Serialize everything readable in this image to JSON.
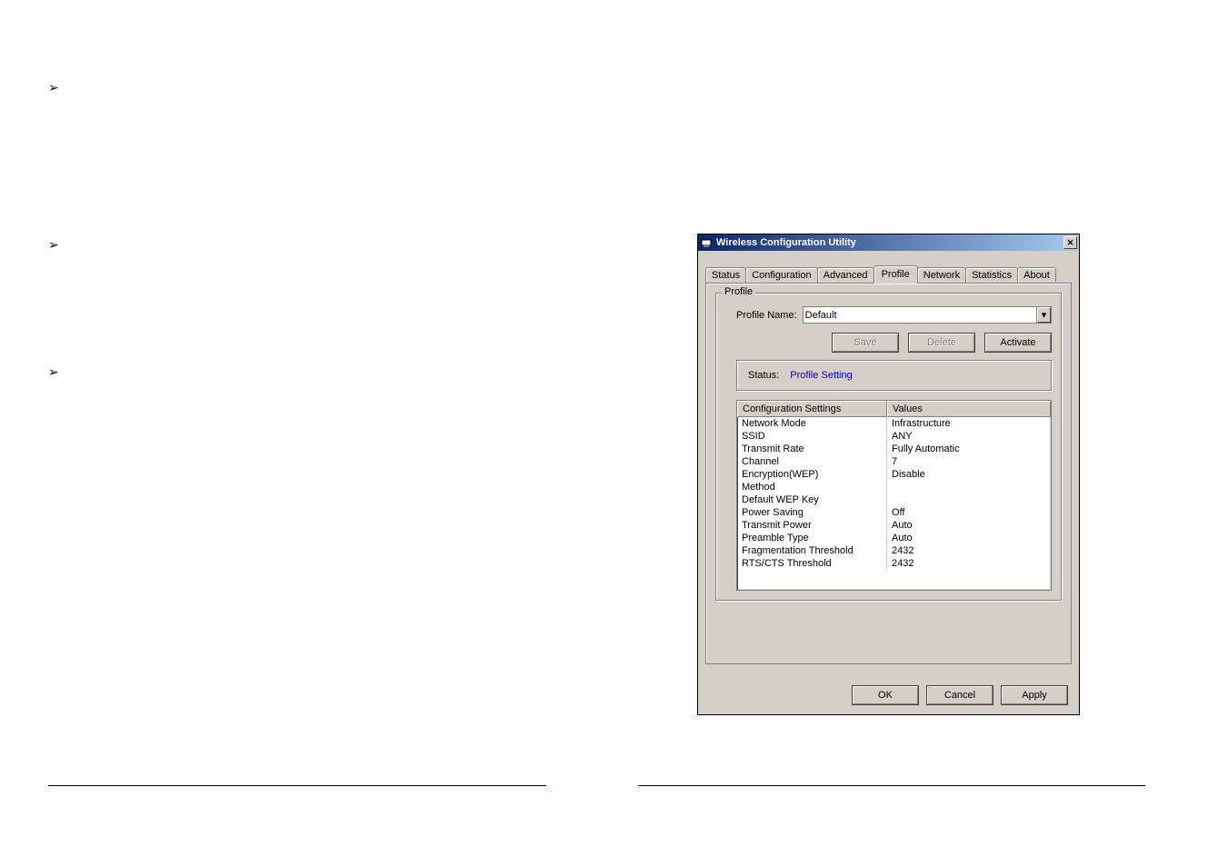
{
  "window": {
    "title": "Wireless Configuration Utility",
    "close": "✕"
  },
  "tabs": [
    {
      "label": "Status"
    },
    {
      "label": "Configuration"
    },
    {
      "label": "Advanced"
    },
    {
      "label": "Profile"
    },
    {
      "label": "Network"
    },
    {
      "label": "Statistics"
    },
    {
      "label": "About"
    }
  ],
  "active_tab_index": 3,
  "profile_group": {
    "legend": "Profile",
    "name_label": "Profile Name:",
    "name_value": "Default",
    "save": "Save",
    "delete": "Delete",
    "activate": "Activate"
  },
  "status": {
    "label": "Status:",
    "value": "Profile Setting"
  },
  "listview": {
    "headers": {
      "col1": "Configuration Settings",
      "col2": "Values"
    },
    "rows": [
      {
        "k": "Network Mode",
        "v": "Infrastructure"
      },
      {
        "k": "SSID",
        "v": "ANY"
      },
      {
        "k": "Transmit Rate",
        "v": "Fully Automatic"
      },
      {
        "k": "Channel",
        "v": "7"
      },
      {
        "k": "Encryption(WEP)",
        "v": "Disable"
      },
      {
        "k": "Method",
        "v": ""
      },
      {
        "k": "Default WEP Key",
        "v": ""
      },
      {
        "k": "Power Saving",
        "v": "Off"
      },
      {
        "k": "Transmit Power",
        "v": "Auto"
      },
      {
        "k": "Preamble Type",
        "v": "Auto"
      },
      {
        "k": "Fragmentation Threshold",
        "v": "2432"
      },
      {
        "k": "RTS/CTS Threshold",
        "v": "2432"
      }
    ]
  },
  "footer": {
    "ok": "OK",
    "cancel": "Cancel",
    "apply": "Apply"
  },
  "bullet_glyph": "➢"
}
